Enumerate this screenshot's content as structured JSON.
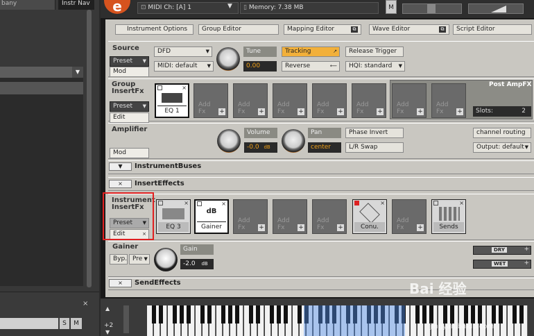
{
  "browser": {
    "top_tab_1": "bany",
    "top_tab_2": "Instr Nav",
    "close": "×",
    "s": "S",
    "m": "M",
    "dropdown_arrow": "▼"
  },
  "header": {
    "logo": "e",
    "midi_channel": "MIDI Ch: [A] 1",
    "memory": "Memory: 7.38 MB",
    "m_button": "M"
  },
  "tabs": {
    "instrument_options": "Instrument Options",
    "group_editor": "Group Editor",
    "mapping_editor": "Mapping Editor",
    "wave_editor": "Wave Editor",
    "script_editor": "Script Editor"
  },
  "source": {
    "title": "Source",
    "preset": "Preset",
    "mod": "Mod",
    "dfd": "DFD",
    "midi_default": "MIDI: default",
    "tune_label": "Tune",
    "tune_value": "0.00",
    "tracking": "Tracking",
    "reverse": "Reverse",
    "release_trigger": "Release Trigger",
    "hqi": "HQI: standard"
  },
  "group_insert": {
    "title_line1": "Group",
    "title_line2": "InsertFx",
    "preset": "Preset",
    "edit": "Edit",
    "eq1": "EQ 1",
    "add": "Add",
    "fx": "Fx",
    "post_amp": "Post AmpFX",
    "slots_label": "Slots:",
    "slots_value": "2"
  },
  "amplifier": {
    "title": "Amplifier",
    "mod": "Mod",
    "volume_label": "Volume",
    "volume_value": "-0.0",
    "volume_unit": "dB",
    "pan_label": "Pan",
    "pan_value": "center",
    "phase_invert": "Phase Invert",
    "lr_swap": "L/R Swap",
    "channel_routing": "channel routing",
    "output": "Output: default"
  },
  "bars": {
    "instrument_buses": "InstrumentBuses",
    "insert_effects": "InsertEffects",
    "send_effects": "SendEffects",
    "collapse_symbol": "▼",
    "close_symbol": "×"
  },
  "instrument_insert": {
    "title_line1": "Instrument",
    "title_line2": "InsertFx",
    "preset": "Preset",
    "edit": "Edit",
    "eq3": "EQ 3",
    "gainer": "Gainer",
    "gainer_db": "dB",
    "conu": "Conu.",
    "sends": "Sends",
    "add": "Add",
    "fx": "Fx"
  },
  "gainer": {
    "title": "Gainer",
    "byp": "Byp.",
    "pre": "Pre",
    "gain_label": "Gain",
    "gain_value": "-2.0",
    "gain_unit": "dB",
    "dry": "DRY",
    "wet": "WET"
  },
  "keyboard": {
    "octave": "+2"
  },
  "watermark": {
    "text": "Bai 经验",
    "sub": "jingyan.baidu.com"
  }
}
